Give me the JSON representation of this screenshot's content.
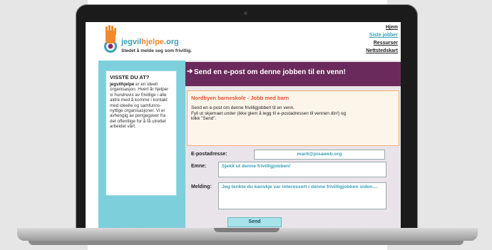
{
  "site": {
    "logo_icon": "hand-target-icon",
    "brand_part1": "jegvil",
    "brand_highlight": "hjelpe",
    "brand_suffix": ".org",
    "tagline": "Stedet å melde seg som frivillig.",
    "nav": [
      "Hjem",
      "Siste jobber",
      "Ressurser",
      "Nettstedskart"
    ]
  },
  "sidebar": {
    "heading": "VISSTE DU AT?",
    "brand_bold": "jegvilhjelpe",
    "text": "er en ideell organisasjon. Hvert år hjelper vi hundrevis av frivillige i alle aldre med å komme i kontakt med ideelle og samfunns-nyttige organisasjoner. Vi er avhengig av pengegaver fra det offentlige for å få utrettet arbeidet vårt."
  },
  "main": {
    "banner_icon": "arrow-icon",
    "banner_title": "Send en e-post om denne jobben til en venn!",
    "job_title": "Nordbyen barneskole - Jobb med barn",
    "job_desc_1": "Send en e-post om denne frivilligjobben til en venn.",
    "job_desc_2": "Fyll ut skjemaet under (ikke glem å legg til e-postadressen til vennen din!) og klikk \"Send\".",
    "form": {
      "email_label": "E-postadresse:",
      "email_value": "marit@pisaweb.org",
      "subject_label": "Emne:",
      "subject_value": "Sjekk ut denne frivilligjobben!",
      "message_label": "Melding:",
      "message_value": "Jeg tenkte du kanskje var interessert i denne frivilligjobben siden....",
      "send_label": "Send"
    }
  },
  "colors": {
    "banner": "#6b2a5c",
    "teal": "#3aa0b8",
    "sidebar": "#7ecfdc",
    "job_title": "#e0532a"
  }
}
